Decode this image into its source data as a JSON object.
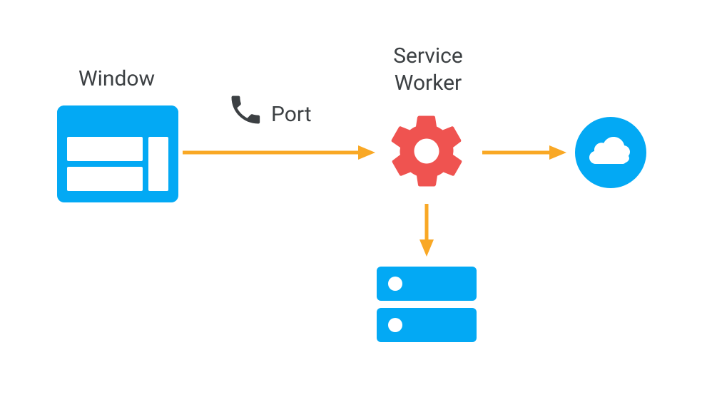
{
  "labels": {
    "window": "Window",
    "port": "Port",
    "service_worker_line1": "Service",
    "service_worker_line2": "Worker"
  },
  "colors": {
    "blue": "#03a9f4",
    "orange": "#f9a825",
    "red": "#ef5350",
    "dark": "#3c4043",
    "white": "#ffffff"
  },
  "nodes": {
    "window": {
      "type": "browser-window",
      "color_role": "blue"
    },
    "port": {
      "type": "phone",
      "color_role": "dark"
    },
    "service_worker": {
      "type": "gear",
      "color_role": "red"
    },
    "cache": {
      "type": "server",
      "color_role": "blue"
    },
    "network": {
      "type": "cloud",
      "color_role": "blue"
    }
  },
  "edges": [
    {
      "from": "window",
      "to": "service_worker",
      "via": "port"
    },
    {
      "from": "service_worker",
      "to": "network"
    },
    {
      "from": "service_worker",
      "to": "cache"
    }
  ]
}
